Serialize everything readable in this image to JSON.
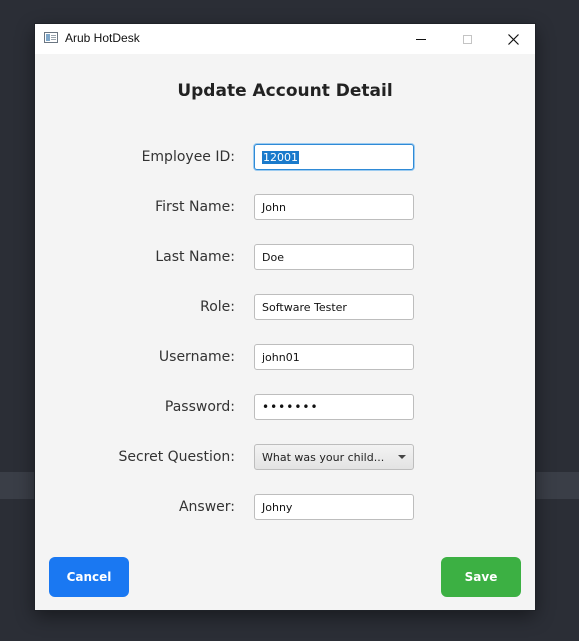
{
  "window": {
    "title": "Arub HotDesk"
  },
  "form": {
    "heading": "Update Account Detail",
    "employee_id": {
      "label": "Employee ID:",
      "value": "12001"
    },
    "first_name": {
      "label": "First Name:",
      "value": "John"
    },
    "last_name": {
      "label": "Last Name:",
      "value": "Doe"
    },
    "role": {
      "label": "Role:",
      "value": "Software Tester"
    },
    "username": {
      "label": "Username:",
      "value": "john01"
    },
    "password": {
      "label": "Password:",
      "value": "•••••••"
    },
    "secret_question": {
      "label": "Secret Question:",
      "value": "What was your child..."
    },
    "answer": {
      "label": "Answer:",
      "value": "Johny"
    }
  },
  "buttons": {
    "cancel": "Cancel",
    "save": "Save"
  },
  "colors": {
    "cancel": "#1a78f2",
    "save": "#3cb043",
    "focus": "#2f8ad6"
  },
  "icons": {
    "app": "app-window-icon",
    "minimize": "minimize-icon",
    "maximize": "maximize-icon",
    "close": "close-icon"
  }
}
